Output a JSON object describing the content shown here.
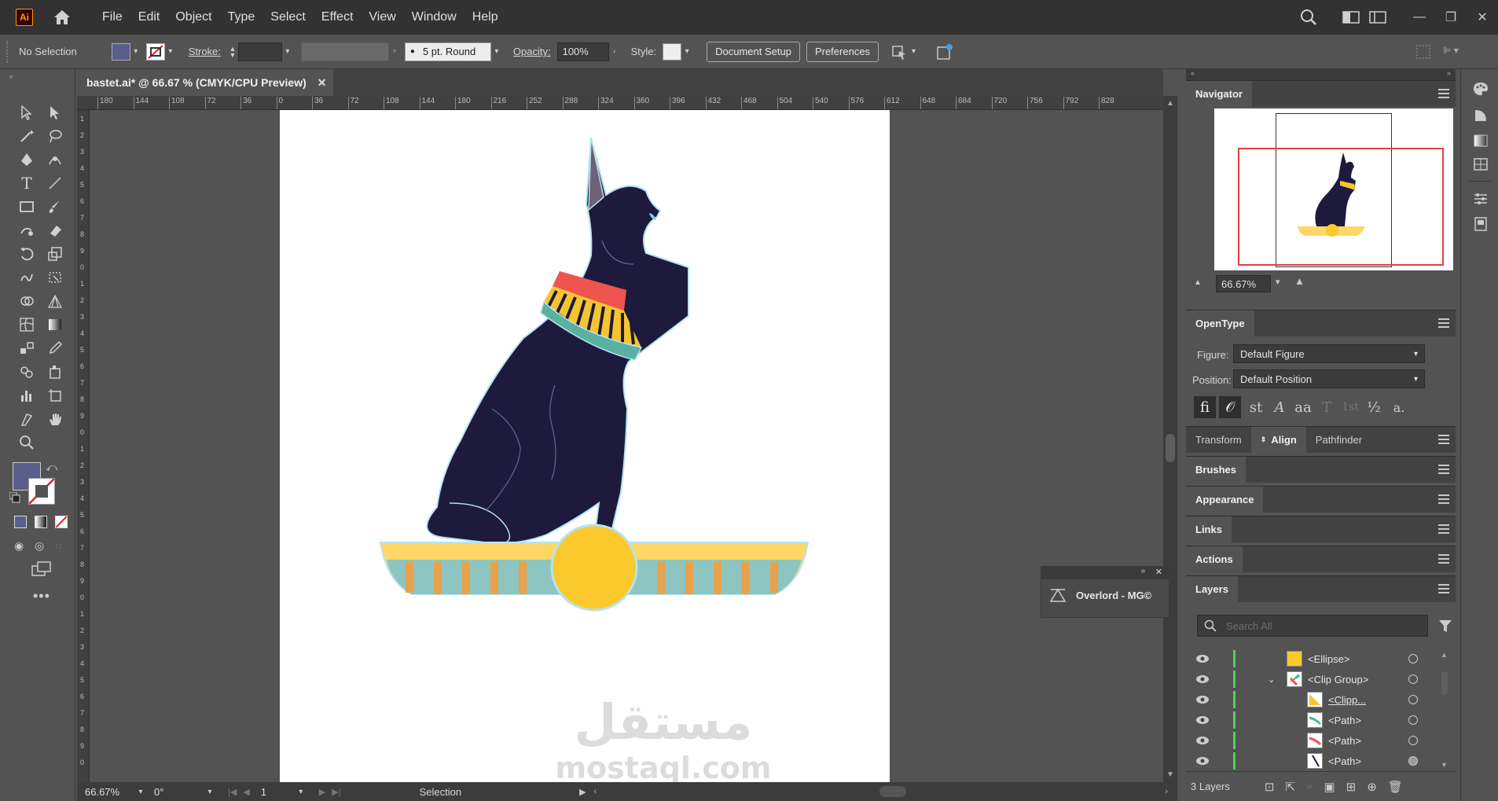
{
  "app": {
    "logo_text": "Ai",
    "menus": [
      "File",
      "Edit",
      "Object",
      "Type",
      "Select",
      "Effect",
      "View",
      "Window",
      "Help"
    ]
  },
  "control_bar": {
    "selection_status": "No Selection",
    "stroke_label": "Stroke:",
    "brush_label": "5 pt. Round",
    "opacity_label": "Opacity:",
    "opacity_value": "100%",
    "style_label": "Style:",
    "document_setup": "Document Setup",
    "preferences": "Preferences"
  },
  "document": {
    "tab_title": "bastet.ai* @ 66.67 % (CMYK/CPU Preview)",
    "ruler_h": [
      "180",
      "144",
      "108",
      "72",
      "36",
      "0",
      "36",
      "72",
      "108",
      "144",
      "180",
      "216",
      "252",
      "288",
      "324",
      "360",
      "396",
      "432",
      "468",
      "504",
      "540",
      "576",
      "612",
      "648",
      "684",
      "720",
      "756",
      "792",
      "828"
    ],
    "ruler_v": [
      "1",
      "2",
      "3",
      "4",
      "5",
      "6",
      "7",
      "8",
      "9",
      "0",
      "1",
      "2",
      "3",
      "4",
      "5",
      "6",
      "7",
      "8",
      "9",
      "0",
      "1",
      "2",
      "3",
      "4",
      "5",
      "6",
      "7",
      "8",
      "9",
      "0",
      "1",
      "2",
      "3",
      "4",
      "5",
      "6",
      "7",
      "8",
      "9",
      "0"
    ],
    "watermark_arabic": "مستقل",
    "watermark_latin": "mostaql.com"
  },
  "status_bar": {
    "zoom": "66.67%",
    "rotation": "0°",
    "artboard_number": "1",
    "tool_status": "Selection"
  },
  "floating_panel": {
    "title": "Overlord - MG©"
  },
  "navigator": {
    "title": "Navigator",
    "zoom": "66.67%"
  },
  "opentype": {
    "title": "OpenType",
    "figure_label": "Figure:",
    "figure_value": "Default Figure",
    "position_label": "Position:",
    "position_value": "Default Position",
    "glyph_buttons": [
      "fi",
      "𝒪",
      "st",
      "A",
      "aa",
      "T",
      "1st",
      "½",
      "a."
    ]
  },
  "panels": {
    "transform": "Transform",
    "align": "Align",
    "pathfinder": "Pathfinder",
    "brushes": "Brushes",
    "appearance": "Appearance",
    "links": "Links",
    "actions": "Actions",
    "layers": "Layers"
  },
  "layers": {
    "search_placeholder": "Search All",
    "count": "3 Layers",
    "rows": [
      {
        "name": "<Ellipse>"
      },
      {
        "name": "<Clip Group>"
      },
      {
        "name": "<Clipp..."
      },
      {
        "name": "<Path>"
      },
      {
        "name": "<Path>"
      },
      {
        "name": "<Path>"
      }
    ]
  },
  "colors": {
    "fill_swatch": "#5a5e8c",
    "cat_body": "#1e1a3d",
    "collar_red": "#f0544f",
    "collar_yellow": "#f5c431",
    "collar_teal": "#5ab0a2",
    "base_yellow": "#ffd766",
    "base_orange": "#e8a24b",
    "base_teal": "#8ec5c0",
    "sun": "#fcc92c",
    "layer_green": "#4fd44f",
    "nav_red": "#e04040"
  }
}
